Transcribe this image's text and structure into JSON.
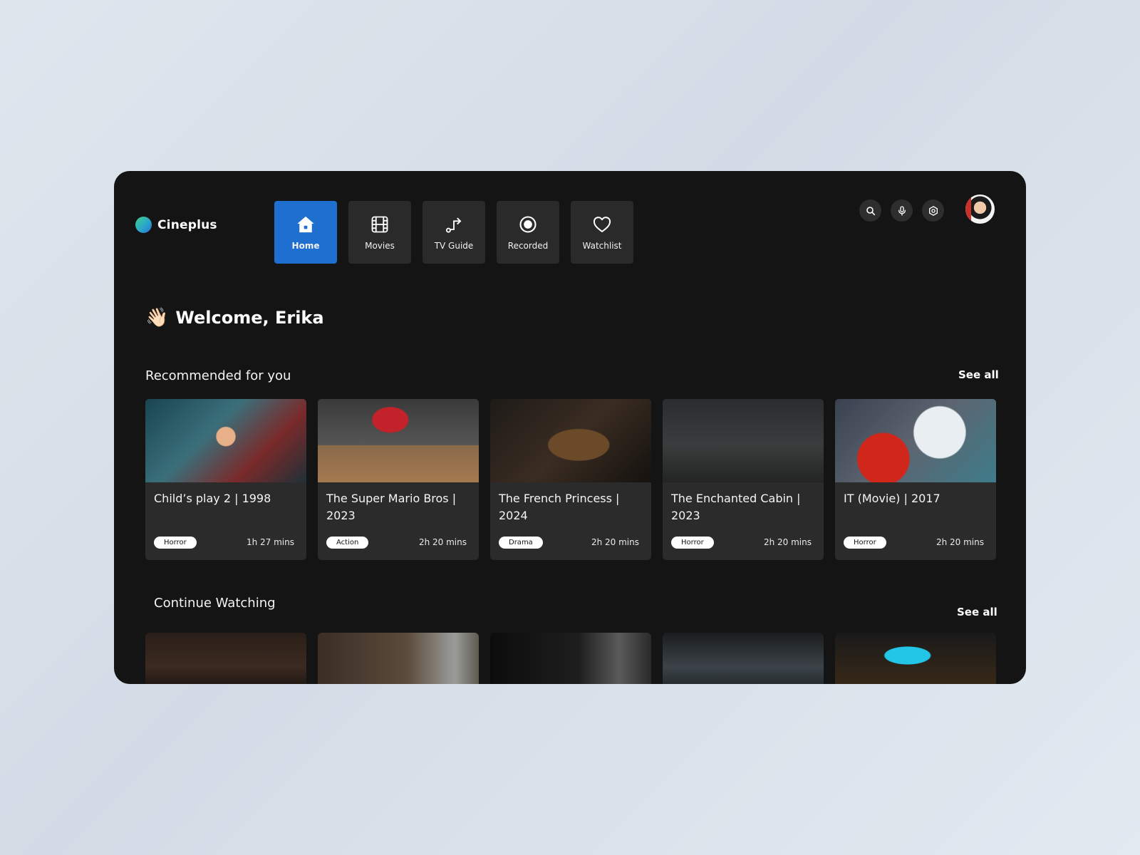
{
  "brand": {
    "name": "Cineplus"
  },
  "nav": [
    {
      "label": "Home",
      "icon": "home-icon",
      "active": true
    },
    {
      "label": "Movies",
      "icon": "film-icon",
      "active": false
    },
    {
      "label": "TV Guide",
      "icon": "route-icon",
      "active": false
    },
    {
      "label": "Recorded",
      "icon": "record-icon",
      "active": false
    },
    {
      "label": "Watchlist",
      "icon": "heart-icon",
      "active": false
    }
  ],
  "top_actions": [
    "search-icon",
    "microphone-icon",
    "settings-icon"
  ],
  "welcome": {
    "emoji": "👋🏻",
    "text": "Welcome, Erika"
  },
  "recommended": {
    "title": "Recommended for you",
    "see_all": "See all",
    "items": [
      {
        "title": "Child’s play  2 | 1998",
        "genre": "Horror",
        "duration": "1h 27 mins"
      },
      {
        "title": "The Super Mario Bros | 2023",
        "genre": "Action",
        "duration": "2h 20 mins"
      },
      {
        "title": "The French Princess | 2024",
        "genre": "Drama",
        "duration": "2h 20 mins"
      },
      {
        "title": "The Enchanted Cabin | 2023",
        "genre": "Horror",
        "duration": "2h 20 mins"
      },
      {
        "title": "IT (Movie) | 2017",
        "genre": "Horror",
        "duration": "2h 20 mins"
      }
    ]
  },
  "continue": {
    "title": "Continue Watching",
    "see_all": "See all"
  },
  "colors": {
    "accent": "#1e6fd0",
    "panel": "#141414",
    "card": "#2b2b2b"
  }
}
